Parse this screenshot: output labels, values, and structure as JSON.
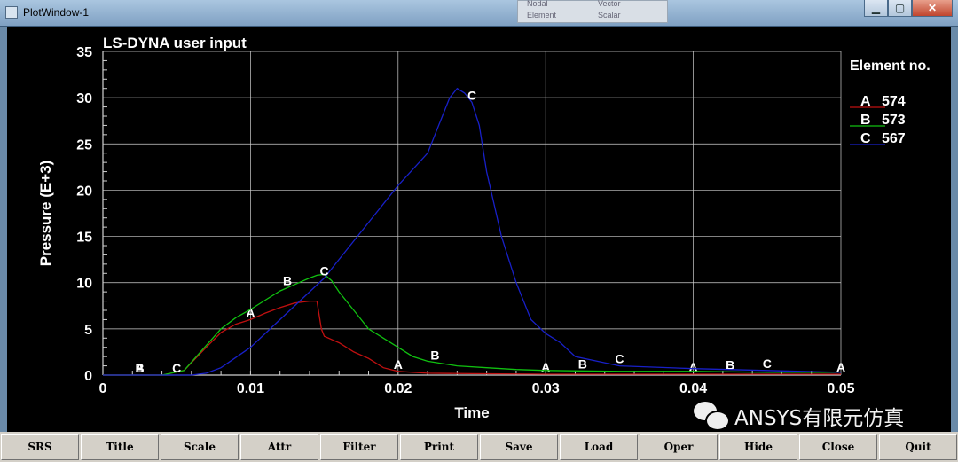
{
  "window": {
    "title": "PlotWindow-1"
  },
  "background_dialog": {
    "options": [
      "Nodal",
      "Element",
      "Vector",
      "Scalar"
    ]
  },
  "toolbar": {
    "buttons": [
      "SRS",
      "Title",
      "Scale",
      "Attr",
      "Filter",
      "Print",
      "Save",
      "Load",
      "Oper",
      "Hide",
      "Close",
      "Quit"
    ]
  },
  "watermark": {
    "text": "ANSYS有限元仿真"
  },
  "colors": {
    "background": "#000000",
    "grid": "#d0d0d0",
    "text": "#ffffff",
    "series_a": "#c01010",
    "series_b": "#10c010",
    "series_c": "#1820c8"
  },
  "chart_data": {
    "type": "line",
    "title": "LS-DYNA user input",
    "xlabel": "Time",
    "ylabel": "Pressure (E+3)",
    "xlim": [
      0,
      0.05
    ],
    "ylim": [
      0,
      35
    ],
    "xticks": [
      "0",
      "0.01",
      "0.02",
      "0.03",
      "0.04",
      "0.05"
    ],
    "yticks": [
      "0",
      "5",
      "10",
      "15",
      "20",
      "25",
      "30",
      "35"
    ],
    "grid": true,
    "legend": {
      "title": "Element no.",
      "position": "right"
    },
    "series": [
      {
        "name": "574",
        "marker": "A",
        "color": "#c01010",
        "x": [
          0,
          0.004,
          0.0055,
          0.007,
          0.008,
          0.009,
          0.01,
          0.011,
          0.012,
          0.013,
          0.014,
          0.0145,
          0.0148,
          0.015,
          0.016,
          0.017,
          0.018,
          0.019,
          0.02,
          0.021,
          0.022,
          0.025,
          0.03,
          0.035,
          0.04,
          0.045,
          0.05
        ],
        "y": [
          0,
          0,
          0.5,
          3.0,
          4.6,
          5.5,
          6.0,
          6.7,
          7.3,
          7.8,
          8.0,
          8.0,
          5.0,
          4.2,
          3.5,
          2.5,
          1.8,
          0.8,
          0.4,
          0.3,
          0.2,
          0.15,
          0.1,
          0.1,
          0.1,
          0.1,
          0.1
        ],
        "marker_x": [
          0.0025,
          0.01,
          0.02,
          0.03,
          0.04,
          0.05
        ]
      },
      {
        "name": "573",
        "marker": "B",
        "color": "#10c010",
        "x": [
          0,
          0.004,
          0.0055,
          0.007,
          0.008,
          0.009,
          0.01,
          0.011,
          0.012,
          0.013,
          0.014,
          0.0145,
          0.015,
          0.0155,
          0.016,
          0.017,
          0.018,
          0.019,
          0.02,
          0.021,
          0.022,
          0.024,
          0.026,
          0.028,
          0.03,
          0.035,
          0.04,
          0.045,
          0.05
        ],
        "y": [
          0,
          0,
          0.5,
          3.2,
          5.0,
          6.2,
          7.1,
          8.1,
          9.1,
          9.8,
          10.5,
          10.8,
          10.9,
          10.2,
          9.0,
          7.0,
          5.0,
          4.0,
          3.0,
          2.0,
          1.5,
          1.0,
          0.8,
          0.6,
          0.5,
          0.4,
          0.4,
          0.3,
          0.3
        ],
        "marker_x": [
          0.0025,
          0.0125,
          0.0225,
          0.0325,
          0.0425
        ]
      },
      {
        "name": "567",
        "marker": "C",
        "color": "#1820c8",
        "x": [
          0,
          0.006,
          0.007,
          0.008,
          0.01,
          0.012,
          0.014,
          0.015,
          0.016,
          0.018,
          0.02,
          0.022,
          0.023,
          0.0235,
          0.024,
          0.0245,
          0.025,
          0.0255,
          0.026,
          0.027,
          0.028,
          0.029,
          0.03,
          0.031,
          0.032,
          0.035,
          0.04,
          0.045,
          0.05
        ],
        "y": [
          0,
          0,
          0.2,
          0.8,
          3.0,
          6.0,
          9.0,
          10.5,
          12.5,
          16.5,
          20.5,
          24.0,
          28.0,
          30.0,
          31.0,
          30.5,
          29.5,
          27.0,
          22.0,
          15.0,
          10.0,
          6.0,
          4.5,
          3.5,
          2.0,
          1.0,
          0.7,
          0.5,
          0.3
        ],
        "marker_x": [
          0.005,
          0.015,
          0.025,
          0.035,
          0.045
        ]
      }
    ]
  }
}
